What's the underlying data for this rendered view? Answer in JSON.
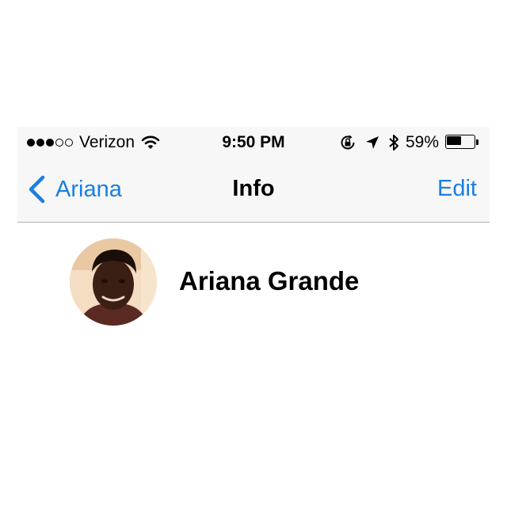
{
  "status_bar": {
    "signal_bars_filled": 3,
    "signal_bars_total": 5,
    "carrier": "Verizon",
    "time": "9:50 PM",
    "battery_percent_label": "59%",
    "battery_level": 0.59,
    "icons": [
      "wifi-icon",
      "rotation-lock-icon",
      "location-arrow-icon",
      "bluetooth-icon",
      "battery-icon"
    ]
  },
  "nav": {
    "back_label": "Ariana",
    "title": "Info",
    "edit_label": "Edit",
    "accent_color": "#1a7fe0"
  },
  "contact": {
    "name": "Ariana Grande",
    "avatar": "contact-photo"
  }
}
